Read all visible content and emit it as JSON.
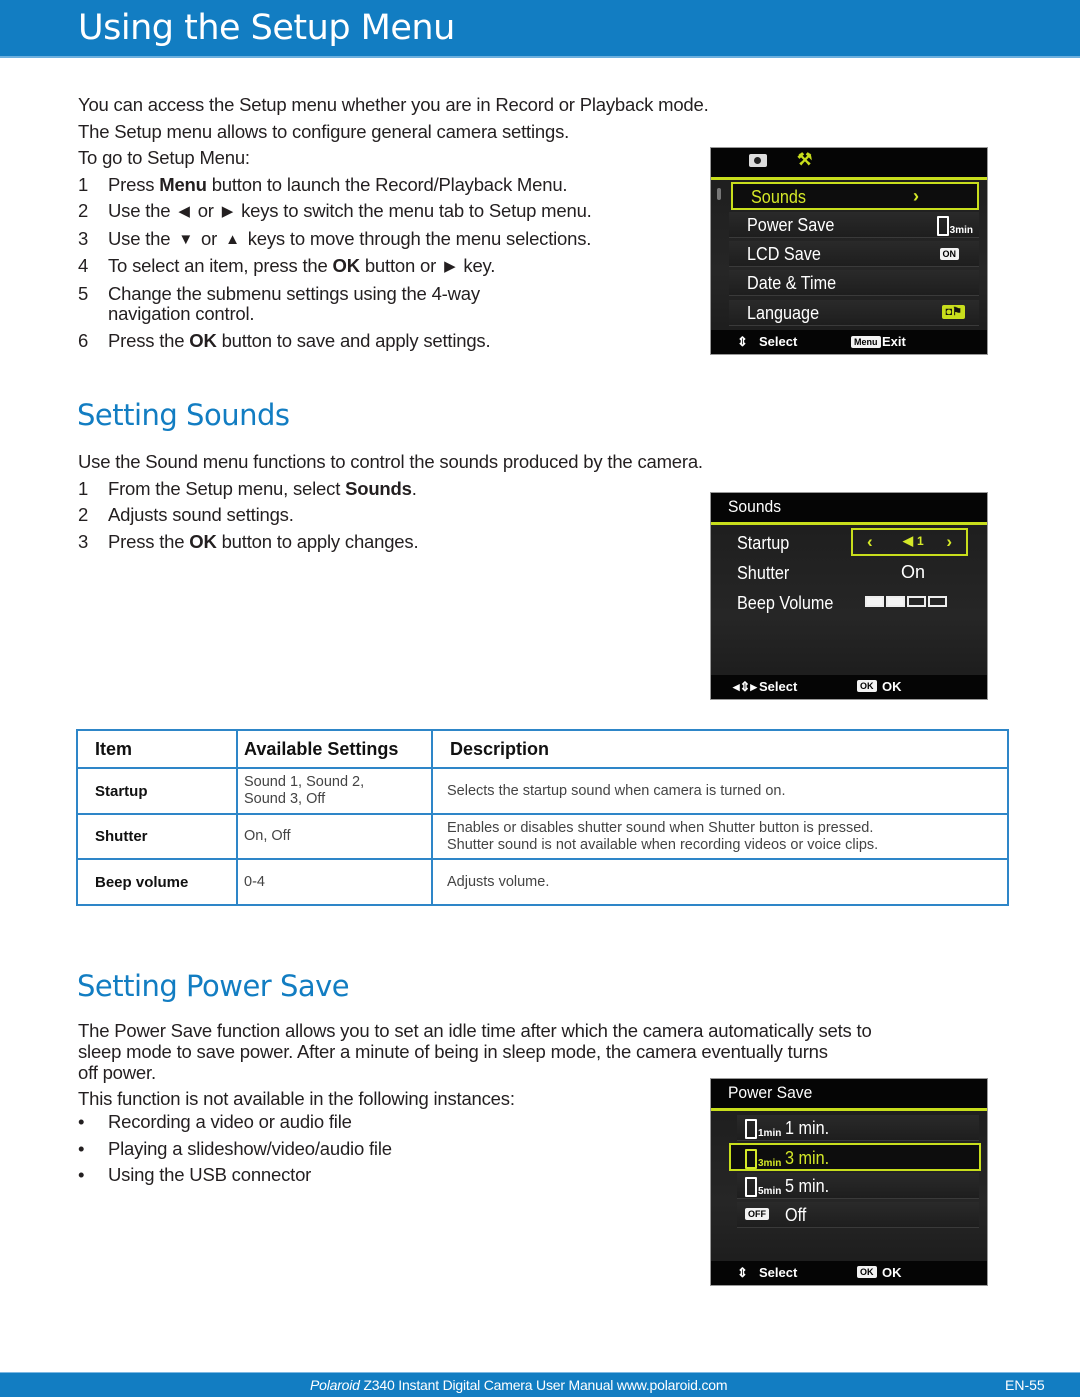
{
  "header": {
    "title": "Using the Setup Menu"
  },
  "intro": {
    "line1": "You can access the Setup menu whether you are in Record or Playback mode.",
    "line2": "The Setup menu allows to configure general camera settings.",
    "line3": "To go to Setup Menu:",
    "steps": [
      {
        "num": "1",
        "pre": "Press ",
        "bold": "Menu",
        "post": " button to launch the Record/Playback Menu."
      },
      {
        "num": "2",
        "pre": "Use the",
        "icon1": "◀",
        "mid": "or",
        "icon2": "▶",
        "post": "keys to switch the menu tab to Setup menu."
      },
      {
        "num": "3",
        "pre": "Use the",
        "icon1": "▼",
        "mid": "or",
        "icon2": "▲",
        "post": "keys to move through the menu selections."
      },
      {
        "num": "4",
        "pre": "To select an item, press the ",
        "bold": "OK",
        "post": " button or",
        "icon2": "▶",
        "post2": "key."
      },
      {
        "num": "5",
        "text": "Change the submenu settings using the 4-way",
        "text2": "navigation control."
      },
      {
        "num": "6",
        "pre": "Press the ",
        "bold": "OK",
        "post": " button to save and apply settings."
      }
    ]
  },
  "setup_screen": {
    "tabs": [
      {
        "icon": "camera-icon",
        "glyph": "◘"
      },
      {
        "icon": "wrench-icon",
        "glyph": "🔧"
      }
    ],
    "items": [
      {
        "label": "Sounds",
        "value": "›",
        "selected": true
      },
      {
        "label": "Power Save",
        "value": "3min"
      },
      {
        "label": "LCD Save",
        "value": "ON"
      },
      {
        "label": "Date & Time",
        "value": ""
      },
      {
        "label": "Language",
        "value": "◘⚑"
      }
    ],
    "footer": {
      "select_glyph": "⇕",
      "select": "Select",
      "menu_badge": "Menu",
      "exit": "Exit"
    }
  },
  "sounds_section": {
    "heading": "Setting Sounds",
    "intro": "Use the Sound menu functions to control the sounds produced by the camera.",
    "steps": [
      {
        "num": "1",
        "pre": "From the Setup menu, select ",
        "bold": "Sounds",
        "post": "."
      },
      {
        "num": "2",
        "text": "Adjusts sound settings."
      },
      {
        "num": "3",
        "pre": "Press the ",
        "bold": "OK",
        "post": " button to apply changes."
      }
    ],
    "screen": {
      "title": "Sounds",
      "startup_label": "Startup",
      "startup_value": "1",
      "startup_left": "‹",
      "startup_right": "›",
      "shutter_label": "Shutter",
      "shutter_value": "On",
      "beep_label": "Beep Volume",
      "beep_level": 2,
      "beep_max": 4,
      "footer": {
        "select_glyph": "◂⇕▸",
        "select": "Select",
        "ok_badge": "OK",
        "ok": "OK"
      }
    },
    "table": {
      "headers": [
        "Item",
        "Available Settings",
        "Description"
      ],
      "rows": [
        {
          "item": "Startup",
          "settings1": "Sound 1, Sound 2,",
          "settings2": "Sound 3, Off",
          "desc1": "Selects the startup sound when camera is turned on.",
          "desc2": ""
        },
        {
          "item": "Shutter",
          "settings1": "On, Off",
          "settings2": "",
          "desc1": "Enables or disables shutter sound when Shutter button is pressed.",
          "desc2": "Shutter sound is not available when recording videos or voice clips."
        },
        {
          "item": "Beep volume",
          "settings1": "0-4",
          "settings2": "",
          "desc1": "Adjusts volume.",
          "desc2": ""
        }
      ]
    }
  },
  "power_section": {
    "heading": "Setting Power Save",
    "para1": "The Power Save function allows you to set an idle time after which the camera automatically sets to",
    "para2": "sleep mode to save power. After a minute of being in sleep mode, the camera eventually turns",
    "para3": "off power.",
    "para4": "This function is not available in the following instances:",
    "bullets": [
      "Recording a video or audio file",
      "Playing a slideshow/video/audio file",
      "Using the USB connector"
    ],
    "screen": {
      "title": "Power Save",
      "options": [
        {
          "icon": "1min",
          "label": "1 min.",
          "selected": false
        },
        {
          "icon": "3min",
          "label": "3 min.",
          "selected": true
        },
        {
          "icon": "5min",
          "label": "5 min.",
          "selected": false
        },
        {
          "icon": "OFF",
          "label": "Off",
          "selected": false
        }
      ],
      "footer": {
        "select_glyph": "⇕",
        "select": "Select",
        "ok_badge": "OK",
        "ok": "OK"
      }
    }
  },
  "footer": {
    "brand": "Polaroid",
    "text": " Z340 Instant Digital Camera User Manual www.polaroid.com",
    "page": "EN-55"
  }
}
